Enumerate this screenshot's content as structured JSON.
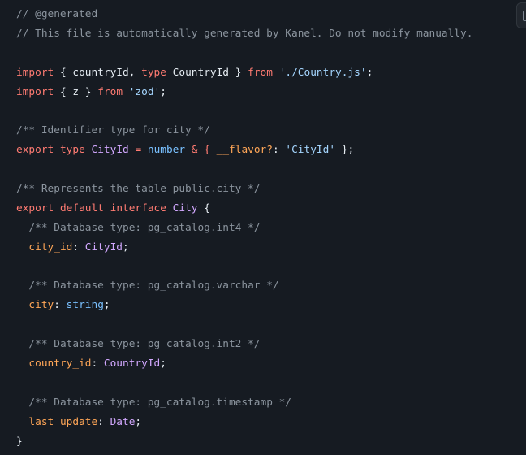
{
  "code": {
    "line1": "// @generated",
    "line2": "// This file is automatically generated by Kanel. Do not modify manually.",
    "import1": {
      "kw": "import",
      "open": " { ",
      "name1": "countryId",
      "comma": ", ",
      "typekw": "type",
      "space": " ",
      "name2": "CountryId",
      "close": " } ",
      "from": "from",
      "sp": " ",
      "path": "'./Country.js'",
      "semi": ";"
    },
    "import2": {
      "kw": "import",
      "open": " { ",
      "name": "z",
      "close": " } ",
      "from": "from",
      "sp": " ",
      "path": "'zod'",
      "semi": ";"
    },
    "comment_identifier": "/** Identifier type for city */",
    "typeline": {
      "export": "export",
      "type": "type",
      "name": "CityId",
      "eq": " = ",
      "number": "number",
      "amp": " & { ",
      "flavor": "__flavor?",
      "colon": ": ",
      "value": "'CityId'",
      "close": " };"
    },
    "comment_table": "/** Represents the table public.city */",
    "iface": {
      "export": "export",
      "default": "default",
      "interface": "interface",
      "name": "City",
      "open": " {"
    },
    "fields": [
      {
        "comment": "/** Database type: pg_catalog.int4 */",
        "name": "city_id",
        "type": "CityId"
      },
      {
        "comment": "/** Database type: pg_catalog.varchar */",
        "name": "city",
        "type": "string"
      },
      {
        "comment": "/** Database type: pg_catalog.int2 */",
        "name": "country_id",
        "type": "CountryId"
      },
      {
        "comment": "/** Database type: pg_catalog.timestamp */",
        "name": "last_update",
        "type": "Date"
      }
    ],
    "close_brace": "}"
  }
}
